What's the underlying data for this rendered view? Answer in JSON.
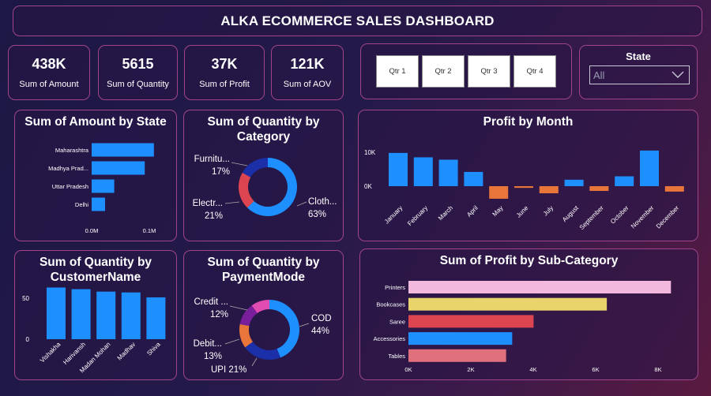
{
  "header": {
    "title": "ALKA ECOMMERCE SALES DASHBOARD"
  },
  "kpis": [
    {
      "value": "438K",
      "label": "Sum of Amount"
    },
    {
      "value": "5615",
      "label": "Sum of Quantity"
    },
    {
      "value": "37K",
      "label": "Sum of Profit"
    },
    {
      "value": "121K",
      "label": "Sum of AOV"
    }
  ],
  "quarter_slicer": {
    "buttons": [
      "Qtr 1",
      "Qtr 2",
      "Qtr 3",
      "Qtr 4"
    ]
  },
  "state_filter": {
    "label": "State",
    "value": "All"
  },
  "colors": {
    "blue": "#1e8fff",
    "orange": "#e8763a",
    "card_border": "#a0448c"
  },
  "chart_data": [
    {
      "id": "amount_by_state",
      "type": "bar",
      "orientation": "horizontal",
      "title": "Sum of Amount by State",
      "categories": [
        "Maharashtra",
        "Madhya Prad...",
        "Uttar Pradesh",
        "Delhi"
      ],
      "values": [
        0.102,
        0.087,
        0.037,
        0.022
      ],
      "xticks": [
        "0.0M",
        "0.1M"
      ],
      "xlim": [
        0,
        0.11
      ]
    },
    {
      "id": "quantity_by_category",
      "type": "pie",
      "donut": true,
      "title": "Sum of Quantity by Category",
      "slices": [
        {
          "label": "Cloth...",
          "pct": "63%",
          "value": 63,
          "color": "#1e8fff"
        },
        {
          "label": "Electr...",
          "pct": "21%",
          "value": 21,
          "color": "#dc4550"
        },
        {
          "label": "Furnitu...",
          "pct": "17%",
          "value": 17,
          "color": "#1a2fa8"
        }
      ]
    },
    {
      "id": "profit_by_month",
      "type": "bar",
      "title": "Profit by Month",
      "categories": [
        "January",
        "February",
        "March",
        "April",
        "May",
        "June",
        "July",
        "August",
        "September",
        "October",
        "November",
        "December"
      ],
      "values": [
        9800,
        8500,
        7800,
        4200,
        -3700,
        -500,
        -2100,
        1900,
        -1400,
        2900,
        10500,
        -1600
      ],
      "yticks": [
        "10K",
        "0K"
      ],
      "ylim": [
        -5000,
        12000
      ]
    },
    {
      "id": "quantity_by_customer",
      "type": "bar",
      "title": "Sum of Quantity by CustomerName",
      "categories": [
        "Vishakha",
        "Harivansh",
        "Madan Mohan",
        "Madhav",
        "Shiva"
      ],
      "values": [
        63,
        61,
        58,
        57,
        51
      ],
      "yticks": [
        "50",
        "0"
      ],
      "ylim": [
        0,
        65
      ]
    },
    {
      "id": "quantity_by_paymentmode",
      "type": "pie",
      "donut": true,
      "title": "Sum of Quantity by PaymentMode",
      "slices": [
        {
          "label": "COD",
          "pct": "44%",
          "value": 44,
          "color": "#1e8fff"
        },
        {
          "label": "UPI",
          "pct": "21%",
          "value": 21,
          "color": "#1a2fa8"
        },
        {
          "label": "Debit...",
          "pct": "13%",
          "value": 13,
          "color": "#e8763a"
        },
        {
          "label": "Credit ...",
          "pct": "12%",
          "value": 12,
          "color": "#7a1f9c"
        },
        {
          "label": "",
          "pct": "",
          "value": 10,
          "color": "#e04cb2"
        }
      ]
    },
    {
      "id": "profit_by_subcategory",
      "type": "bar",
      "orientation": "horizontal",
      "title": "Sum of Profit by Sub-Category",
      "categories": [
        "Printers",
        "Bookcases",
        "Saree",
        "Accessories",
        "Tables"
      ],
      "values": [
        8600,
        6500,
        4100,
        3400,
        3200
      ],
      "colors": [
        "#f3b8dd",
        "#e8d46a",
        "#dc4550",
        "#1e8fff",
        "#e0707c"
      ],
      "xticks": [
        "0K",
        "2K",
        "4K",
        "6K",
        "8K"
      ],
      "xlim": [
        0,
        8800
      ]
    }
  ]
}
